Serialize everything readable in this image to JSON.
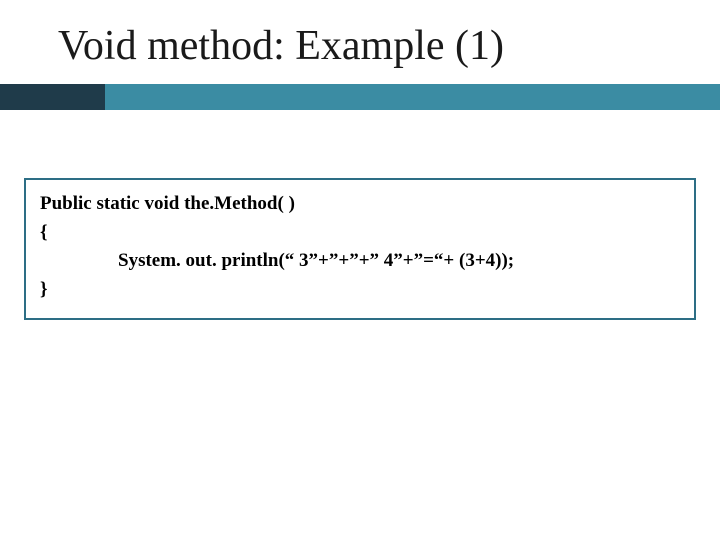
{
  "slide": {
    "title": "Void method: Example (1)"
  },
  "code": {
    "line1": "Public static void the.Method( )",
    "line2": "{",
    "line3": "System. out. println(“ 3”+”+”+” 4”+”=“+ (3+4));",
    "line4": "}"
  }
}
